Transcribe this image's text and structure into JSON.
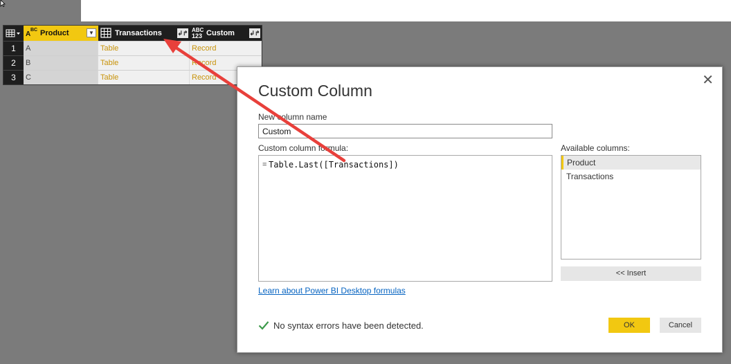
{
  "grid": {
    "columns": [
      {
        "label": "Product",
        "type_top": "A",
        "type_bottom": "BC"
      },
      {
        "label": "Transactions"
      },
      {
        "label": "Custom",
        "type_top": "ABC",
        "type_bottom": "123"
      }
    ],
    "rows": [
      {
        "num": "1",
        "product": "A",
        "transactions": "Table",
        "custom": "Record"
      },
      {
        "num": "2",
        "product": "B",
        "transactions": "Table",
        "custom": "Record"
      },
      {
        "num": "3",
        "product": "C",
        "transactions": "Table",
        "custom": "Record"
      }
    ]
  },
  "dialog": {
    "title": "Custom Column",
    "close": "✕",
    "new_column_label": "New column name",
    "new_column_value": "Custom",
    "formula_label": "Custom column formula:",
    "formula_eq": "=",
    "formula": "Table.Last([Transactions])",
    "available_label": "Available columns:",
    "available": [
      "Product",
      "Transactions"
    ],
    "insert_label": "<< Insert",
    "learn_link": "Learn about Power BI Desktop formulas",
    "status": "No syntax errors have been detected.",
    "ok_label": "OK",
    "cancel_label": "Cancel"
  },
  "colors": {
    "accent": "#f2c811",
    "annotation_arrow": "#e8403b",
    "link": "#0563c1",
    "record_text": "#c8930a"
  }
}
